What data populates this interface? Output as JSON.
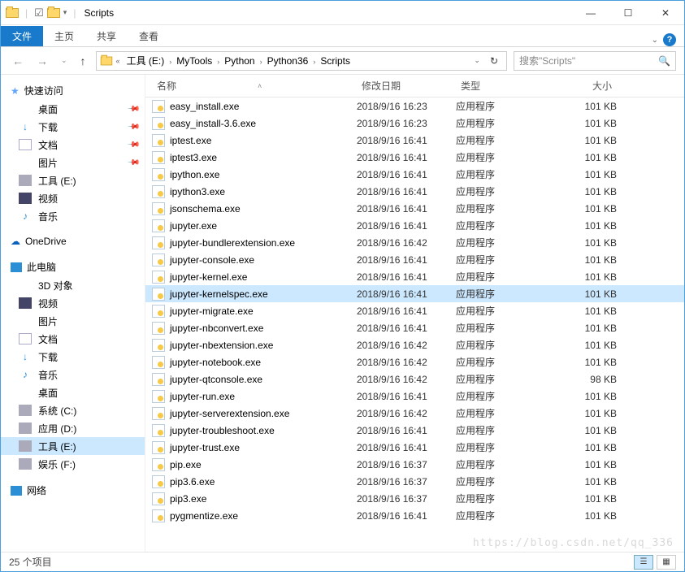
{
  "title": "Scripts",
  "ribbon": {
    "file": "文件",
    "tabs": [
      "主页",
      "共享",
      "查看"
    ]
  },
  "breadcrumbs": {
    "prefix": "«",
    "items": [
      "工具 (E:)",
      "MyTools",
      "Python",
      "Python36",
      "Scripts"
    ]
  },
  "search": {
    "placeholder": "搜索\"Scripts\""
  },
  "sidebar": {
    "quick": {
      "label": "快速访问",
      "items": [
        {
          "icon": "desk",
          "label": "桌面",
          "pin": true
        },
        {
          "icon": "dl",
          "label": "下载",
          "pin": true
        },
        {
          "icon": "doc",
          "label": "文档",
          "pin": true
        },
        {
          "icon": "pic",
          "label": "图片",
          "pin": true
        },
        {
          "icon": "drive",
          "label": "工具 (E:)",
          "pin": false
        },
        {
          "icon": "vid",
          "label": "视频",
          "pin": false
        },
        {
          "icon": "music",
          "label": "音乐",
          "pin": false
        }
      ]
    },
    "onedrive": "OneDrive",
    "thispc": {
      "label": "此电脑",
      "items": [
        {
          "icon": "3d",
          "label": "3D 对象"
        },
        {
          "icon": "vid",
          "label": "视频"
        },
        {
          "icon": "pic",
          "label": "图片"
        },
        {
          "icon": "doc",
          "label": "文档"
        },
        {
          "icon": "dl",
          "label": "下载"
        },
        {
          "icon": "music",
          "label": "音乐"
        },
        {
          "icon": "desk",
          "label": "桌面"
        },
        {
          "icon": "drive",
          "label": "系统 (C:)"
        },
        {
          "icon": "drive",
          "label": "应用 (D:)"
        },
        {
          "icon": "drive",
          "label": "工具 (E:)",
          "selected": true
        },
        {
          "icon": "drive",
          "label": "娱乐 (F:)"
        }
      ]
    },
    "network": "网络"
  },
  "columns": {
    "name": "名称",
    "date": "修改日期",
    "type": "类型",
    "size": "大小"
  },
  "files": [
    {
      "name": "easy_install.exe",
      "date": "2018/9/16 16:23",
      "type": "应用程序",
      "size": "101 KB"
    },
    {
      "name": "easy_install-3.6.exe",
      "date": "2018/9/16 16:23",
      "type": "应用程序",
      "size": "101 KB"
    },
    {
      "name": "iptest.exe",
      "date": "2018/9/16 16:41",
      "type": "应用程序",
      "size": "101 KB"
    },
    {
      "name": "iptest3.exe",
      "date": "2018/9/16 16:41",
      "type": "应用程序",
      "size": "101 KB"
    },
    {
      "name": "ipython.exe",
      "date": "2018/9/16 16:41",
      "type": "应用程序",
      "size": "101 KB"
    },
    {
      "name": "ipython3.exe",
      "date": "2018/9/16 16:41",
      "type": "应用程序",
      "size": "101 KB"
    },
    {
      "name": "jsonschema.exe",
      "date": "2018/9/16 16:41",
      "type": "应用程序",
      "size": "101 KB"
    },
    {
      "name": "jupyter.exe",
      "date": "2018/9/16 16:41",
      "type": "应用程序",
      "size": "101 KB"
    },
    {
      "name": "jupyter-bundlerextension.exe",
      "date": "2018/9/16 16:42",
      "type": "应用程序",
      "size": "101 KB"
    },
    {
      "name": "jupyter-console.exe",
      "date": "2018/9/16 16:41",
      "type": "应用程序",
      "size": "101 KB"
    },
    {
      "name": "jupyter-kernel.exe",
      "date": "2018/9/16 16:41",
      "type": "应用程序",
      "size": "101 KB"
    },
    {
      "name": "jupyter-kernelspec.exe",
      "date": "2018/9/16 16:41",
      "type": "应用程序",
      "size": "101 KB",
      "selected": true
    },
    {
      "name": "jupyter-migrate.exe",
      "date": "2018/9/16 16:41",
      "type": "应用程序",
      "size": "101 KB"
    },
    {
      "name": "jupyter-nbconvert.exe",
      "date": "2018/9/16 16:41",
      "type": "应用程序",
      "size": "101 KB"
    },
    {
      "name": "jupyter-nbextension.exe",
      "date": "2018/9/16 16:42",
      "type": "应用程序",
      "size": "101 KB"
    },
    {
      "name": "jupyter-notebook.exe",
      "date": "2018/9/16 16:42",
      "type": "应用程序",
      "size": "101 KB"
    },
    {
      "name": "jupyter-qtconsole.exe",
      "date": "2018/9/16 16:42",
      "type": "应用程序",
      "size": "98 KB"
    },
    {
      "name": "jupyter-run.exe",
      "date": "2018/9/16 16:41",
      "type": "应用程序",
      "size": "101 KB"
    },
    {
      "name": "jupyter-serverextension.exe",
      "date": "2018/9/16 16:42",
      "type": "应用程序",
      "size": "101 KB"
    },
    {
      "name": "jupyter-troubleshoot.exe",
      "date": "2018/9/16 16:41",
      "type": "应用程序",
      "size": "101 KB"
    },
    {
      "name": "jupyter-trust.exe",
      "date": "2018/9/16 16:41",
      "type": "应用程序",
      "size": "101 KB"
    },
    {
      "name": "pip.exe",
      "date": "2018/9/16 16:37",
      "type": "应用程序",
      "size": "101 KB"
    },
    {
      "name": "pip3.6.exe",
      "date": "2018/9/16 16:37",
      "type": "应用程序",
      "size": "101 KB"
    },
    {
      "name": "pip3.exe",
      "date": "2018/9/16 16:37",
      "type": "应用程序",
      "size": "101 KB"
    },
    {
      "name": "pygmentize.exe",
      "date": "2018/9/16 16:41",
      "type": "应用程序",
      "size": "101 KB"
    }
  ],
  "status": "25 个项目",
  "watermark": "https://blog.csdn.net/qq_336"
}
